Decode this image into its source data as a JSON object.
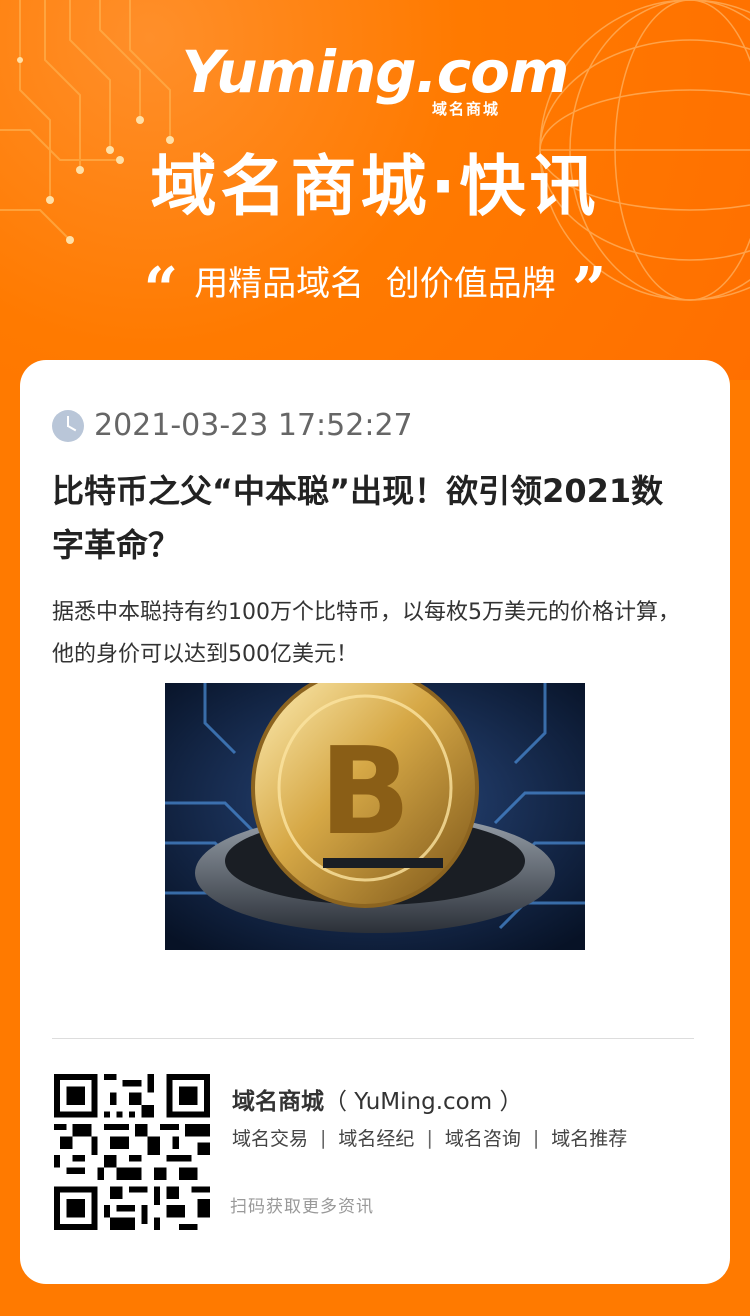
{
  "header": {
    "logo_text": "Yuming.com",
    "logo_sub": "域名商城",
    "title": "域名商城·快讯",
    "slogan": "用精品域名  创价值品牌",
    "quote_open": "“",
    "quote_close": "”"
  },
  "article": {
    "datetime": "2021-03-23 17:52:27",
    "title": "比特币之父“中本聪”出现！欲引领2021数字革命？",
    "summary": "据悉中本聪持有约100万个比特币，以每枚5万美元的价格计算，他的身价可以达到500亿美元！",
    "image_icon": "bitcoin-coin-image"
  },
  "footer": {
    "brand_name": "域名商城",
    "brand_domain": "（ YuMing.com ）",
    "links": [
      "域名交易",
      "域名经纪",
      "域名咨询",
      "域名推荐"
    ],
    "separator": "|",
    "scan_hint": "扫码获取更多资讯"
  },
  "colors": {
    "brand_orange": "#ff7a00",
    "card_bg": "#ffffff",
    "clock_icon": "#b9c6d8"
  }
}
